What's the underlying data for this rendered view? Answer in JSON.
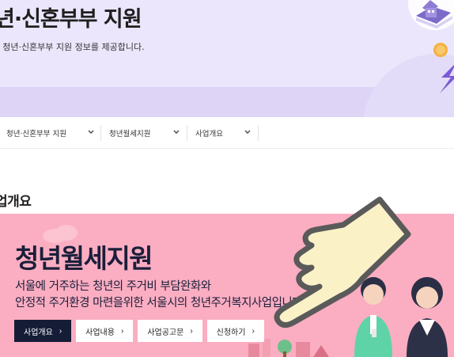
{
  "hero": {
    "title": "년·신혼부부 지원",
    "subtitle": "| 청년·신혼부부 지원 정보를 제공합니다."
  },
  "nav": {
    "items": [
      {
        "label": "청년·신혼부부 지원"
      },
      {
        "label": "청년월세지원"
      },
      {
        "label": "사업개요"
      }
    ]
  },
  "section": {
    "title": "업개요"
  },
  "banner": {
    "title": "청년월세지원",
    "desc_line1": "서울에 거주하는 청년의 주거비 부담완화와",
    "desc_line2": "안정적 주거환경 마련을위한 서울시의 청년주거복지사업입니다",
    "buttons": [
      {
        "label": "사업개요"
      },
      {
        "label": "사업내용"
      },
      {
        "label": "사업공고문"
      },
      {
        "label": "신청하기"
      }
    ]
  },
  "colors": {
    "hero_bg": "#ebe6fb",
    "banner_bg": "#fbadc1",
    "primary_button": "#151c36"
  },
  "icons": [
    "chevron-down-icon",
    "chevron-right-icon",
    "pointing-hand-icon",
    "house-illustration",
    "coin-icon"
  ]
}
